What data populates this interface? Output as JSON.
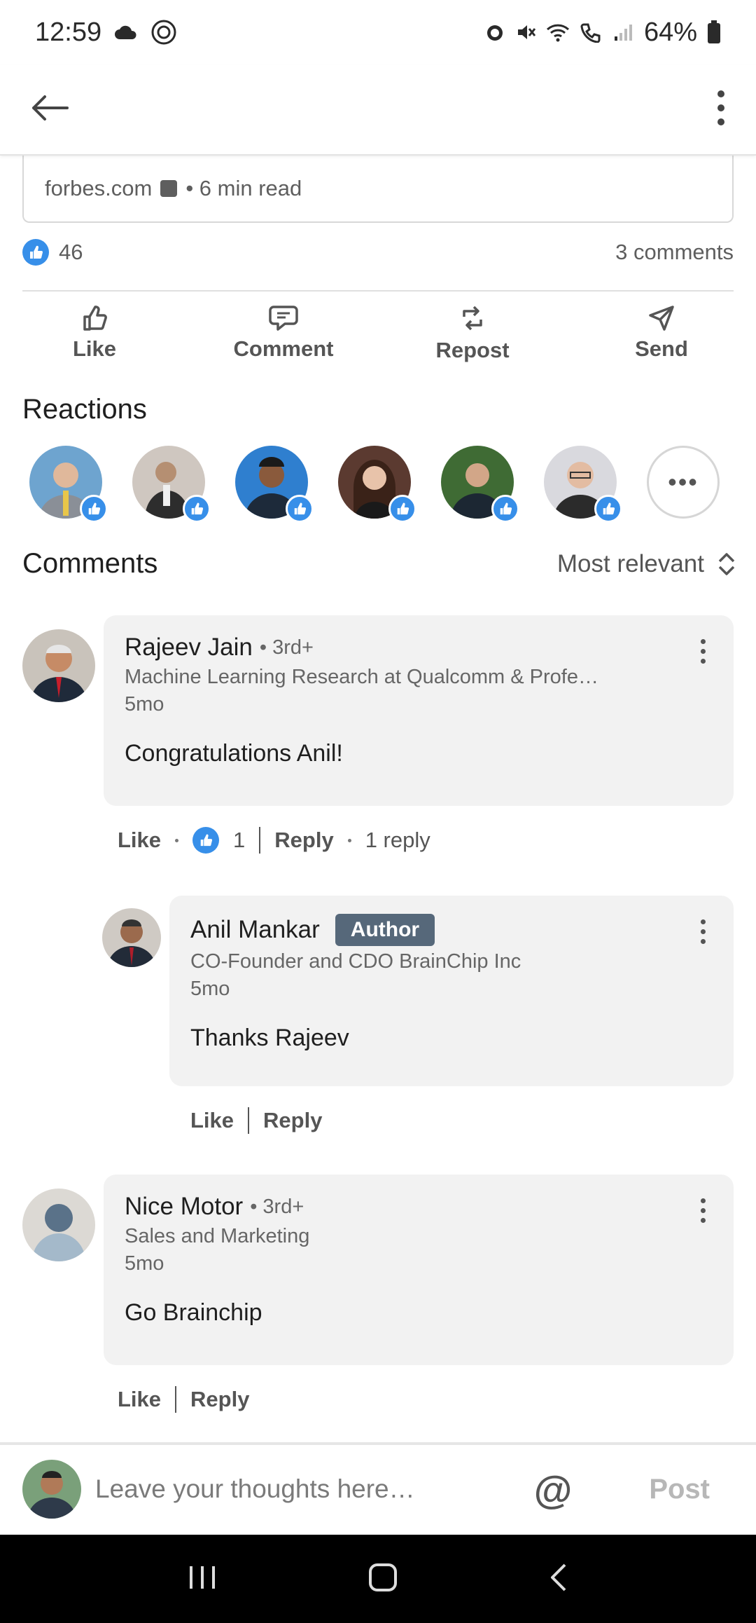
{
  "status_bar": {
    "time": "12:59",
    "battery": "64%",
    "icons": [
      "cloud-icon",
      "at-icon",
      "alarm-icon",
      "mute-icon",
      "wifi-icon",
      "wifi-call-icon",
      "signal-icon",
      "battery-icon"
    ]
  },
  "app_bar": {
    "back_icon": "back-arrow-icon",
    "menu_icon": "more-vertical-icon"
  },
  "article": {
    "source": "forbes.com",
    "read_time": "• 6 min read"
  },
  "social": {
    "reaction_count": "46",
    "comment_count": "3 comments"
  },
  "actions": [
    {
      "label": "Like",
      "icon": "thumb-up-icon"
    },
    {
      "label": "Comment",
      "icon": "comment-icon"
    },
    {
      "label": "Repost",
      "icon": "repost-icon"
    },
    {
      "label": "Send",
      "icon": "send-icon"
    }
  ],
  "reactions": {
    "title": "Reactions",
    "more": "•••"
  },
  "comments_section": {
    "title": "Comments",
    "sort_label": "Most relevant"
  },
  "comments": [
    {
      "name": "Rajeev Jain",
      "degree": "• 3rd+",
      "headline": "Machine Learning Research at Qualcomm & Profe…",
      "time": "5mo",
      "text": "Congratulations Anil!",
      "like": "Like",
      "like_count": "1",
      "reply": "Reply",
      "reply_count": "1 reply"
    },
    {
      "name": "Anil Mankar",
      "badge": "Author",
      "headline": "CO-Founder and CDO BrainChip Inc",
      "time": "5mo",
      "text": "Thanks Rajeev",
      "like": "Like",
      "reply": "Reply"
    },
    {
      "name": "Nice Motor",
      "degree": "• 3rd+",
      "headline": "Sales and Marketing",
      "time": "5mo",
      "text": "Go Brainchip",
      "like": "Like",
      "reply": "Reply"
    }
  ],
  "composer": {
    "placeholder": "Leave your thoughts here…",
    "mention": "@",
    "post_label": "Post"
  },
  "colors": {
    "accent": "#378fe9",
    "author_badge": "#56687a",
    "bubble": "#f2f2f2"
  }
}
